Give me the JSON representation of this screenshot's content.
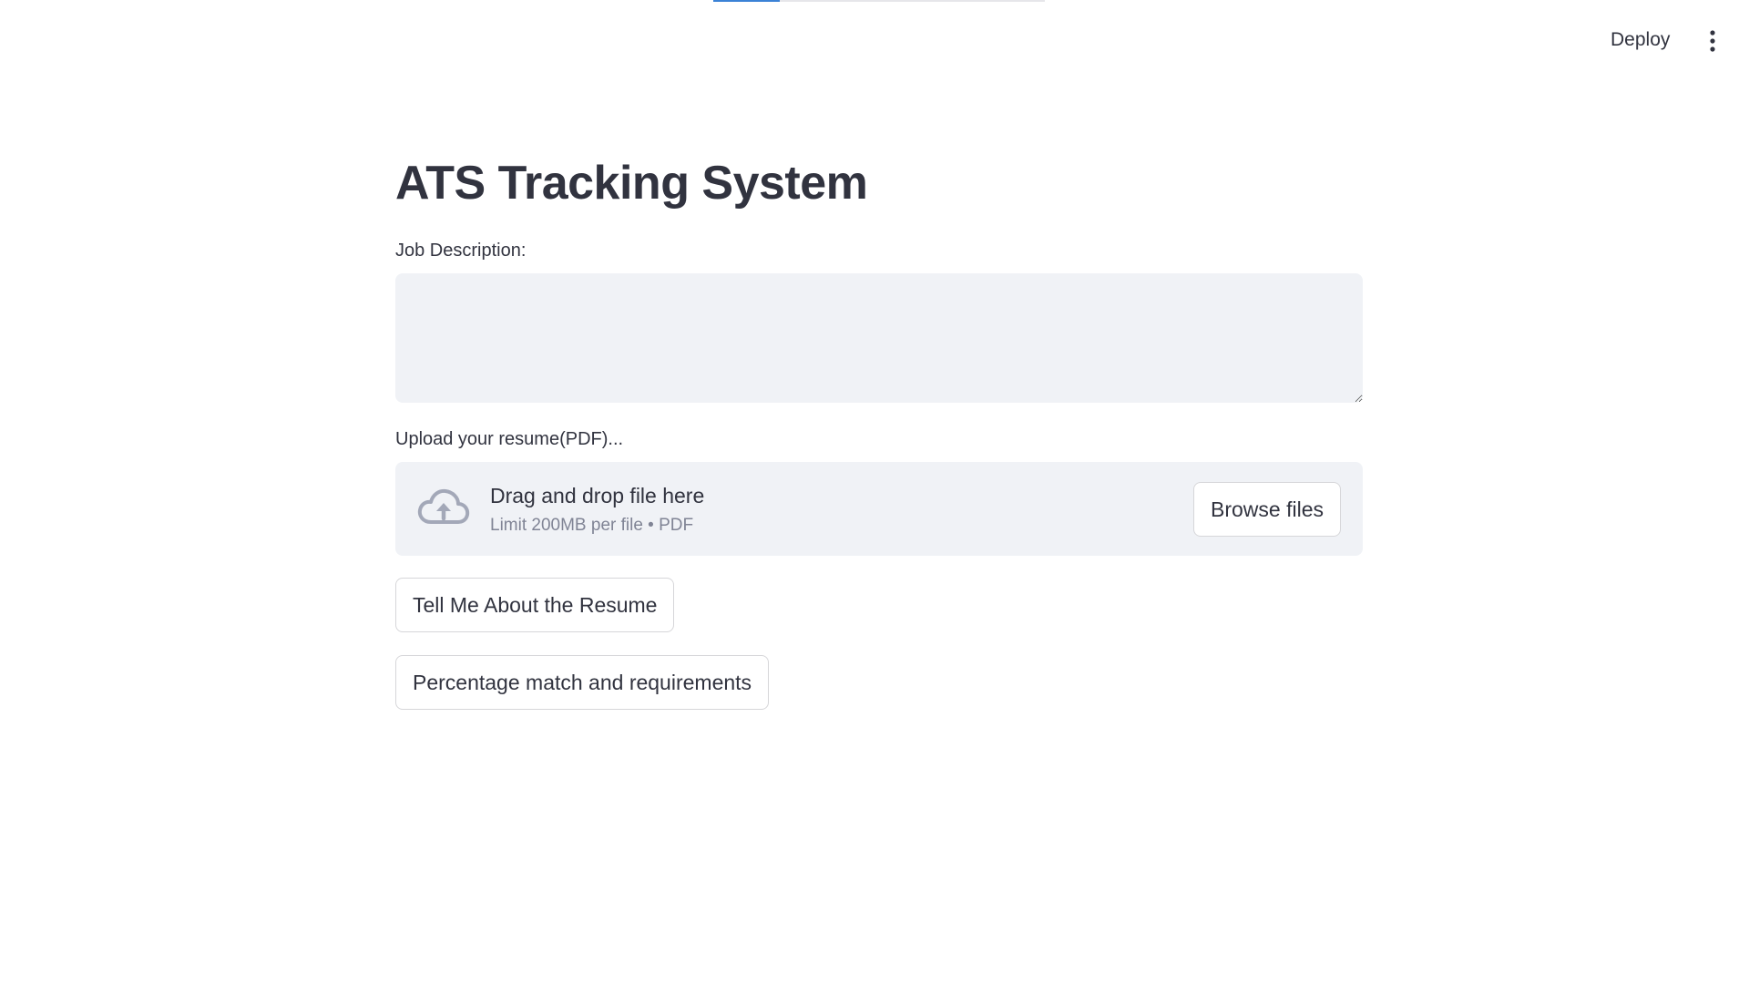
{
  "header": {
    "deploy_label": "Deploy",
    "menu_icon": "vertical-ellipsis-icon"
  },
  "page": {
    "title": "ATS Tracking System"
  },
  "job_description": {
    "label": "Job Description:",
    "value": ""
  },
  "upload": {
    "label": "Upload your resume(PDF)...",
    "icon": "cloud-upload-icon",
    "dropzone_text": "Drag and drop file here",
    "limit_text": "Limit 200MB per file • PDF",
    "browse_label": "Browse files"
  },
  "actions": {
    "tell_me_label": "Tell Me About the Resume",
    "percentage_label": "Percentage match and requirements"
  },
  "colors": {
    "accent": "#3b82d6",
    "text": "#31333f",
    "muted": "#808495",
    "input_bg": "#f0f2f6"
  }
}
